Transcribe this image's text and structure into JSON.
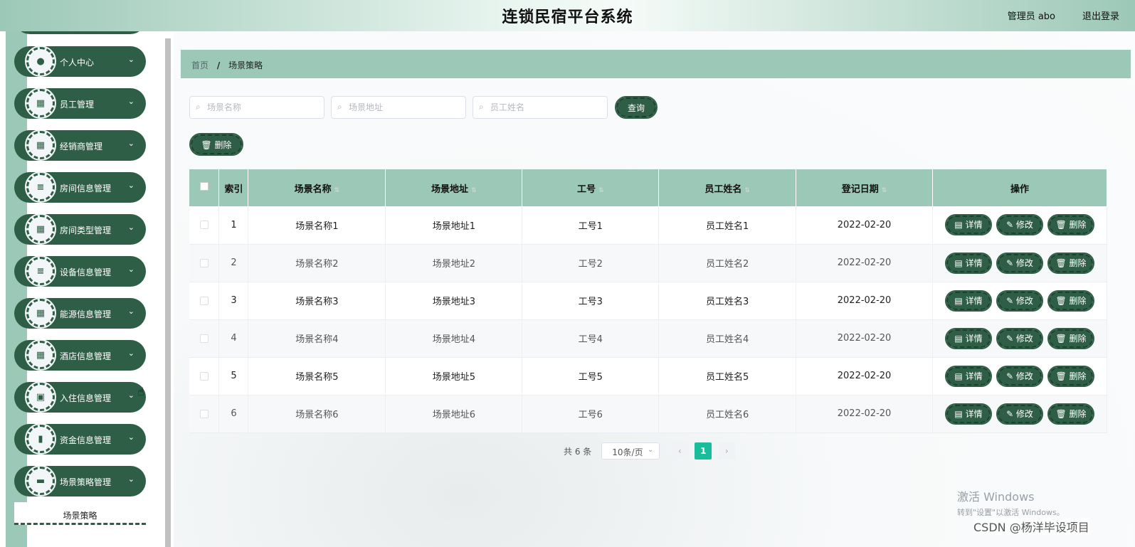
{
  "header": {
    "title": "连锁民宿平台系统",
    "user": "管理员 abo",
    "logout": "退出登录"
  },
  "sidebar": {
    "items": [
      {
        "label": "个人中心",
        "icon": "person-icon",
        "glyph": "●"
      },
      {
        "label": "员工管理",
        "icon": "grid-icon",
        "glyph": "▦"
      },
      {
        "label": "经销商管理",
        "icon": "grid-icon",
        "glyph": "▦"
      },
      {
        "label": "房间信息管理",
        "icon": "list-icon",
        "glyph": "≡"
      },
      {
        "label": "房间类型管理",
        "icon": "grid-icon",
        "glyph": "▦"
      },
      {
        "label": "设备信息管理",
        "icon": "list-icon",
        "glyph": "≡"
      },
      {
        "label": "能源信息管理",
        "icon": "apps-icon",
        "glyph": "▦"
      },
      {
        "label": "酒店信息管理",
        "icon": "grid-icon",
        "glyph": "▦"
      },
      {
        "label": "入住信息管理",
        "icon": "chart-icon",
        "glyph": "▣"
      },
      {
        "label": "资金信息管理",
        "icon": "bar-chart-icon",
        "glyph": "▮"
      },
      {
        "label": "场景策略管理",
        "icon": "monitor-icon",
        "glyph": "▬"
      }
    ],
    "chevron": "⌄",
    "submenu": "场景策略"
  },
  "breadcrumb": {
    "home": "首页",
    "sep": "/",
    "current": "场景策略"
  },
  "search": {
    "name_placeholder": "场景名称",
    "address_placeholder": "场景地址",
    "employee_placeholder": "员工姓名",
    "query_label": "查询"
  },
  "toolbar": {
    "delete_label": "🗑 删除"
  },
  "table": {
    "headers": {
      "index": "索引",
      "name": "场景名称",
      "address": "场景地址",
      "emp_no": "工号",
      "emp_name": "员工姓名",
      "date": "登记日期",
      "ops": "操作"
    },
    "rows": [
      {
        "index": "1",
        "name": "场景名称1",
        "address": "场景地址1",
        "emp_no": "工号1",
        "emp_name": "员工姓名1",
        "date": "2022-02-20"
      },
      {
        "index": "2",
        "name": "场景名称2",
        "address": "场景地址2",
        "emp_no": "工号2",
        "emp_name": "员工姓名2",
        "date": "2022-02-20"
      },
      {
        "index": "3",
        "name": "场景名称3",
        "address": "场景地址3",
        "emp_no": "工号3",
        "emp_name": "员工姓名3",
        "date": "2022-02-20"
      },
      {
        "index": "4",
        "name": "场景名称4",
        "address": "场景地址4",
        "emp_no": "工号4",
        "emp_name": "员工姓名4",
        "date": "2022-02-20"
      },
      {
        "index": "5",
        "name": "场景名称5",
        "address": "场景地址5",
        "emp_no": "工号5",
        "emp_name": "员工姓名5",
        "date": "2022-02-20"
      },
      {
        "index": "6",
        "name": "场景名称6",
        "address": "场景地址6",
        "emp_no": "工号6",
        "emp_name": "员工姓名6",
        "date": "2022-02-20"
      }
    ],
    "actions": {
      "detail": "▤ 详情",
      "edit": "✎ 修改",
      "delete": "🗑 删除"
    }
  },
  "pagination": {
    "total": "共 6 条",
    "page_size": "10条/页",
    "prev": "‹",
    "current_page": "1",
    "next": "›"
  },
  "watermark": {
    "line1": "激活 Windows",
    "line2": "转到\"设置\"以激活 Windows。",
    "csdn": "CSDN @杨洋毕设项目"
  },
  "colors": {
    "primary": "#2e5e45",
    "accent": "#9cc8b7",
    "page_active": "#1abc9c"
  }
}
